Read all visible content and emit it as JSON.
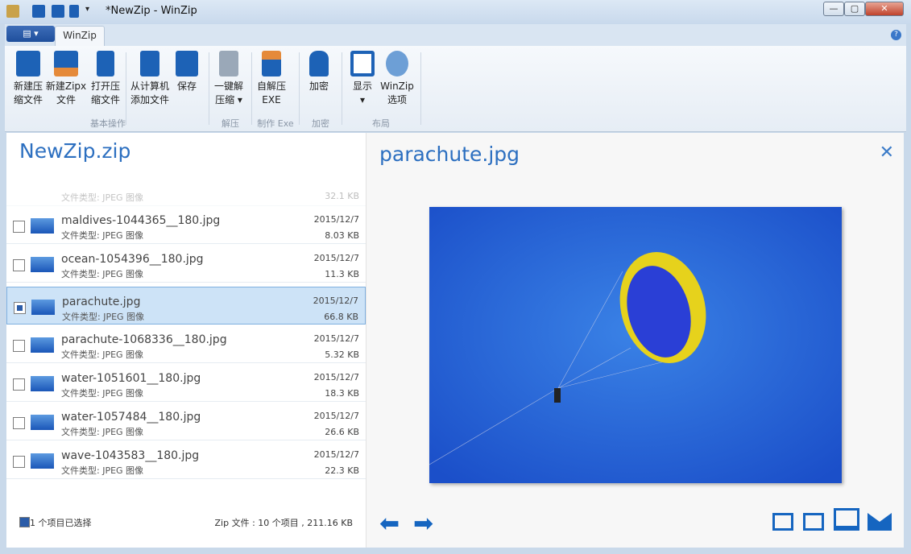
{
  "window": {
    "title": "*NewZip - WinZip",
    "min": "—",
    "max": "▢",
    "close": "✕"
  },
  "tabs": {
    "file_menu": "▤ ▾",
    "winzip": "WinZip",
    "help": "?"
  },
  "ribbon": {
    "buttons": [
      {
        "l1": "新建压",
        "l2": "缩文件"
      },
      {
        "l1": "新建Zipx",
        "l2": "文件"
      },
      {
        "l1": "打开压",
        "l2": "缩文件"
      },
      {
        "l1": "从计算机",
        "l2": "添加文件"
      },
      {
        "l1": "保存",
        "l2": ""
      },
      {
        "l1": "一键解",
        "l2": "压缩 ▾"
      },
      {
        "l1": "自解压",
        "l2": "EXE"
      },
      {
        "l1": "加密",
        "l2": ""
      },
      {
        "l1": "显示",
        "l2": "▾"
      },
      {
        "l1": "WinZip",
        "l2": "选项"
      }
    ],
    "groups": [
      "基本操作",
      "解压",
      "制作 Exe",
      "加密",
      "布局"
    ]
  },
  "left": {
    "title": "NewZip.zip",
    "partial": {
      "type": "文件类型: JPEG 图像",
      "size": "32.1 KB"
    },
    "files": [
      {
        "name": "maldives-1044365__180.jpg",
        "type": "文件类型: JPEG 图像",
        "date": "2015/12/7",
        "size": "8.03 KB",
        "checked": false
      },
      {
        "name": "ocean-1054396__180.jpg",
        "type": "文件类型: JPEG 图像",
        "date": "2015/12/7",
        "size": "11.3 KB",
        "checked": false
      },
      {
        "name": "parachute.jpg",
        "type": "文件类型: JPEG 图像",
        "date": "2015/12/7",
        "size": "66.8 KB",
        "checked": true
      },
      {
        "name": "parachute-1068336__180.jpg",
        "type": "文件类型: JPEG 图像",
        "date": "2015/12/7",
        "size": "5.32 KB",
        "checked": false
      },
      {
        "name": "water-1051601__180.jpg",
        "type": "文件类型: JPEG 图像",
        "date": "2015/12/7",
        "size": "18.3 KB",
        "checked": false
      },
      {
        "name": "water-1057484__180.jpg",
        "type": "文件类型: JPEG 图像",
        "date": "2015/12/7",
        "size": "26.6 KB",
        "checked": false
      },
      {
        "name": "wave-1043583__180.jpg",
        "type": "文件类型: JPEG 图像",
        "date": "2015/12/7",
        "size": "22.3 KB",
        "checked": false
      }
    ],
    "selected_status": "1 个项目已选择",
    "zip_status": "Zip 文件 : 10 个项目 , 211.16 KB"
  },
  "preview": {
    "title": "parachute.jpg",
    "close": "✕",
    "prev": "⬅",
    "next": "➡"
  },
  "colors": {
    "accent": "#2c6fc0",
    "icon": "#1565c0"
  }
}
